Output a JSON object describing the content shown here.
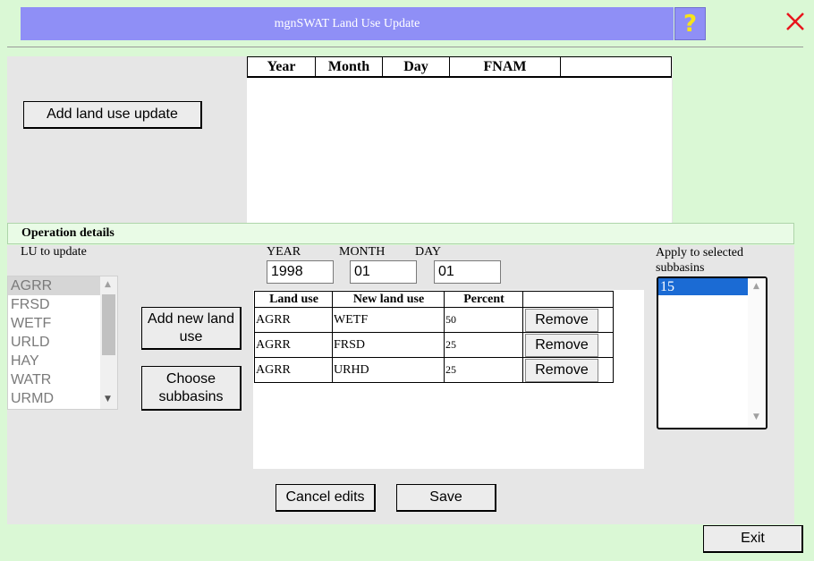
{
  "window": {
    "title": "mgnSWAT Land Use Update",
    "help_label": "?",
    "close_label": "×"
  },
  "updates_table": {
    "columns": [
      "Year",
      "Month",
      "Day",
      "FNAM",
      ""
    ]
  },
  "buttons": {
    "add_land_use_update": "Add land use update",
    "add_new_land_use": "Add new land use",
    "choose_subbasins": "Choose subbasins",
    "cancel_edits": "Cancel edits",
    "save": "Save",
    "exit": "Exit",
    "remove": "Remove"
  },
  "operation": {
    "header": "Operation details",
    "lu_to_update_label": "LU to update",
    "lu_options": [
      "AGRR",
      "FRSD",
      "WETF",
      "URLD",
      "HAY",
      "WATR",
      "URMD"
    ],
    "lu_selected": "AGRR",
    "year_label": "YEAR",
    "month_label": "MONTH",
    "day_label": "DAY",
    "year": "1998",
    "month": "01",
    "day": "01",
    "table_columns": [
      "Land use",
      "New land use",
      "Percent",
      ""
    ],
    "rows": [
      {
        "land_use": "AGRR",
        "new_land_use": "WETF",
        "percent": "50"
      },
      {
        "land_use": "AGRR",
        "new_land_use": "FRSD",
        "percent": "25"
      },
      {
        "land_use": "AGRR",
        "new_land_use": "URHD",
        "percent": "25"
      }
    ],
    "apply_label": "Apply to selected subbasins",
    "subbasins": [
      "15"
    ]
  },
  "colors": {
    "background": "#daf8d5",
    "title_bar": "#8f8ff6",
    "help_icon": "#f7e41a",
    "close_icon": "#e8141c",
    "selection": "#1b6bd4"
  }
}
